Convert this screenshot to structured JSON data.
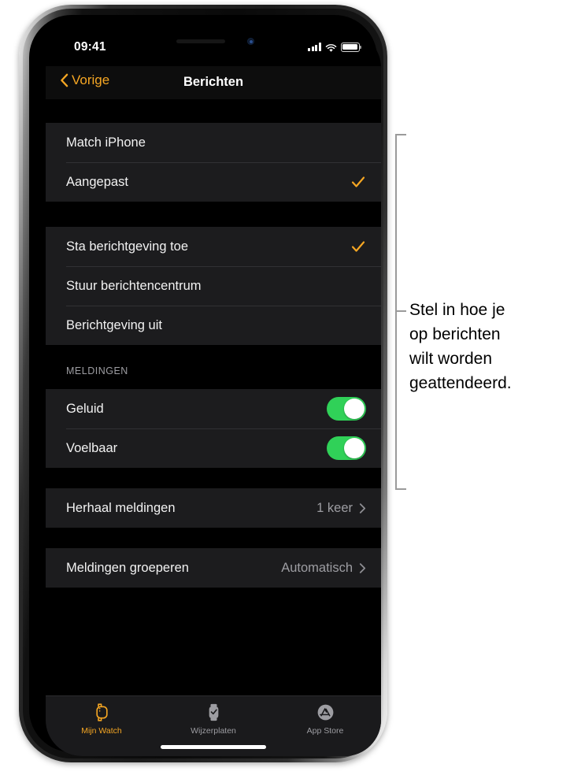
{
  "device": {
    "statusbar": {
      "time": "09:41",
      "signal_icon": "cellular-signal-icon",
      "wifi_icon": "wifi-icon",
      "battery_icon": "battery-icon"
    },
    "home_indicator": "home-indicator"
  },
  "navbar": {
    "back_label": "Vorige",
    "back_icon": "chevron-left-icon",
    "title": "Berichten"
  },
  "sections": [
    {
      "header": null,
      "rows": [
        {
          "label": "Match iPhone",
          "type": "option",
          "checked": false
        },
        {
          "label": "Aangepast",
          "type": "option",
          "checked": true
        }
      ]
    },
    {
      "header": null,
      "rows": [
        {
          "label": "Sta berichtgeving toe",
          "type": "option",
          "checked": true
        },
        {
          "label": "Stuur berichtencentrum",
          "type": "option",
          "checked": false
        },
        {
          "label": "Berichtgeving uit",
          "type": "option",
          "checked": false
        }
      ]
    },
    {
      "header": "MELDINGEN",
      "rows": [
        {
          "label": "Geluid",
          "type": "toggle",
          "on": true
        },
        {
          "label": "Voelbaar",
          "type": "toggle",
          "on": true
        }
      ]
    },
    {
      "header": null,
      "rows": [
        {
          "label": "Herhaal meldingen",
          "type": "disclosure",
          "value": "1 keer"
        }
      ]
    },
    {
      "header": null,
      "rows": [
        {
          "label": "Meldingen groeperen",
          "type": "disclosure",
          "value": "Automatisch"
        }
      ]
    }
  ],
  "tabbar": {
    "tabs": [
      {
        "label": "Mijn Watch",
        "icon": "watch-face-outline-icon",
        "active": true
      },
      {
        "label": "Wijzerplaten",
        "icon": "watch-clock-icon",
        "active": false
      },
      {
        "label": "App Store",
        "icon": "app-store-icon",
        "active": false
      }
    ]
  },
  "callout": {
    "text": "Stel in hoe je op berichten wilt worden geattendeerd.",
    "lines": [
      "Stel in hoe je",
      "op berichten",
      "wilt worden",
      "geattendeerd."
    ]
  },
  "colors": {
    "accent": "#f5a623",
    "toggle_on": "#30d158",
    "row_bg": "#1c1c1e",
    "screen_bg": "#000000",
    "separator": "#313134",
    "secondary_text": "#9d9da2",
    "callout_line": "#9a9a9a"
  }
}
